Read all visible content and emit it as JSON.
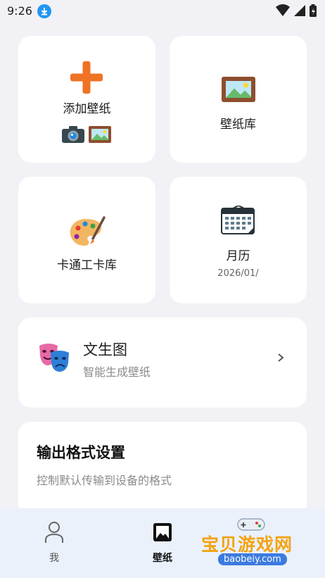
{
  "status": {
    "time": "9:26"
  },
  "tiles": {
    "add_wallpaper": "添加壁纸",
    "wallpaper_library": "壁纸库",
    "cartoon_library": "卡通工卡库",
    "calendar": "月历",
    "calendar_date": "2026/01/"
  },
  "ai_card": {
    "title": "文生图",
    "subtitle": "智能生成壁纸"
  },
  "format_card": {
    "title": "输出格式设置",
    "subtitle": "控制默认传输到设备的格式"
  },
  "bottom_nav": {
    "items": [
      {
        "label": "我",
        "icon": "person-icon",
        "active": false
      },
      {
        "label": "壁纸",
        "icon": "image-icon",
        "active": true
      }
    ]
  },
  "watermark": {
    "main": "宝贝游戏网",
    "sub": "baobeiy.com"
  },
  "colors": {
    "accent_orange": "#f07224",
    "nav_bg": "#eaf1fb",
    "card_bg": "#ffffff"
  }
}
